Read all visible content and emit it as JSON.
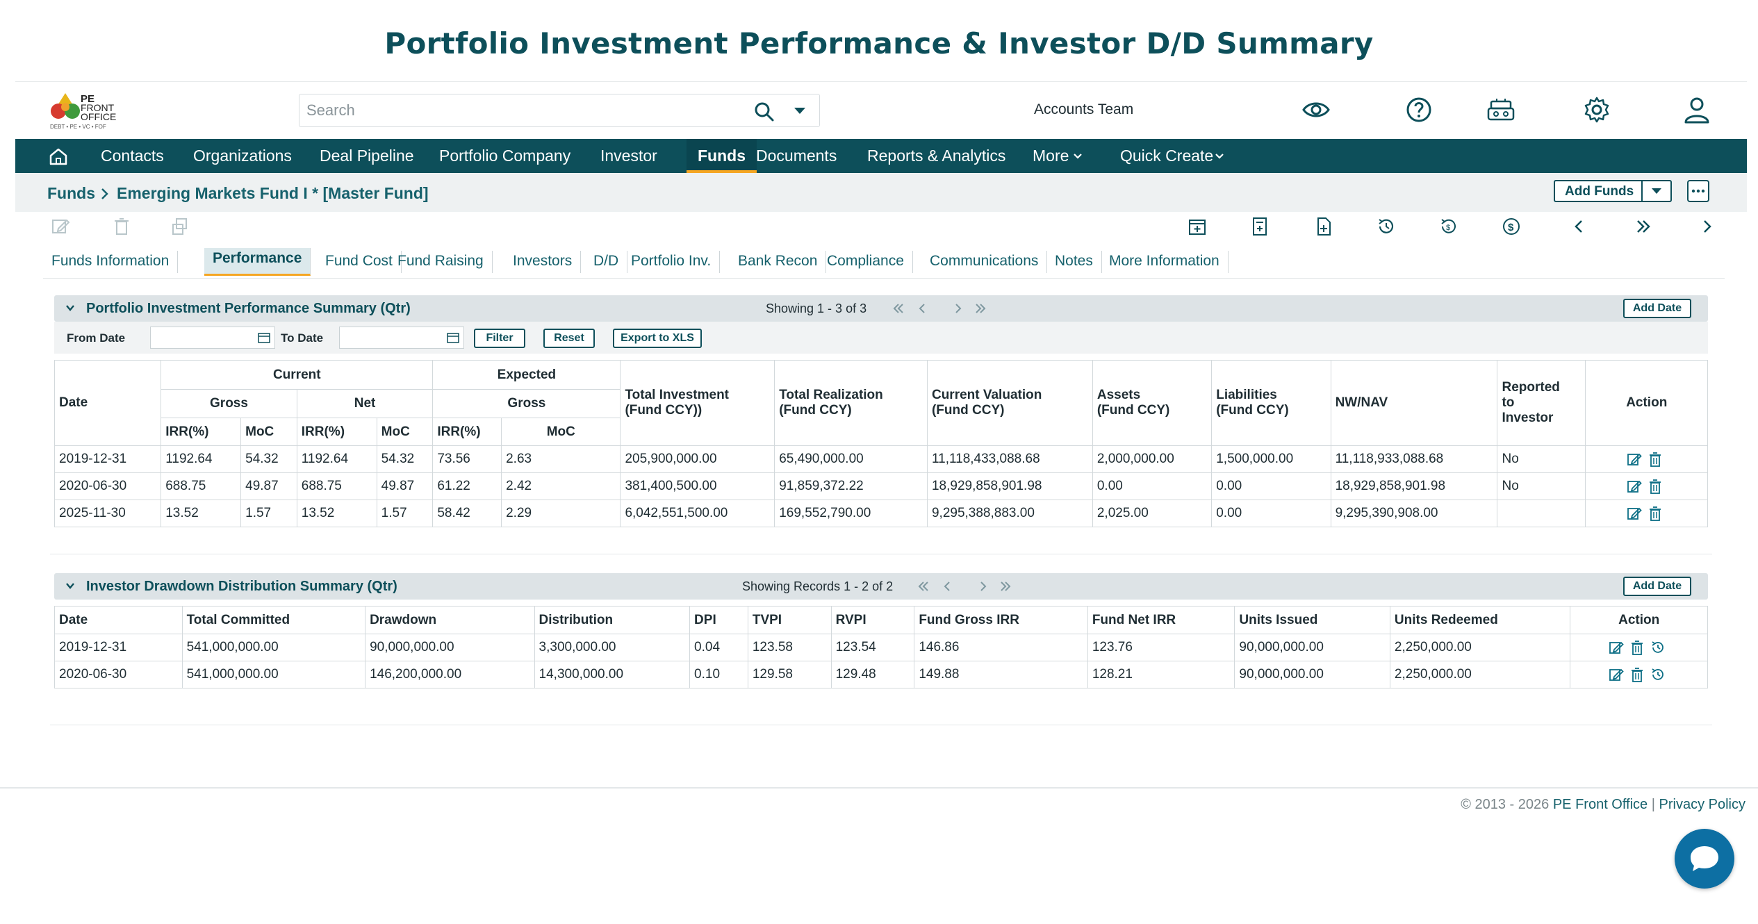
{
  "page_title": "Portfolio Investment Performance & Investor D/D Summary",
  "header": {
    "logo": {
      "line1": "PE",
      "line2": "FRONT",
      "line3": "OFFICE",
      "tagline": "DEBT • PE • VC • FOF"
    },
    "search_placeholder": "Search",
    "team": "Accounts Team",
    "icons": [
      "eye-icon",
      "help-icon",
      "robot-icon",
      "gear-icon",
      "user-icon"
    ]
  },
  "nav": {
    "items": [
      "Contacts",
      "Organizations",
      "Deal Pipeline",
      "Portfolio Company",
      "Investor",
      "Funds",
      "Documents",
      "Reports & Analytics",
      "More",
      "Quick Create"
    ],
    "active": "Funds"
  },
  "breadcrumb": {
    "root": "Funds",
    "current": "Emerging Markets Fund I * [Master Fund]"
  },
  "add_funds_label": "Add Funds",
  "tabs": [
    "Funds Information",
    "Performance",
    "Fund Cost",
    "Fund Raising",
    "Investors",
    "D/D",
    "Portfolio Inv.",
    "Bank Recon",
    "Compliance",
    "Communications",
    "Notes",
    "More Information"
  ],
  "active_tab": "Performance",
  "perf": {
    "title": "Portfolio Investment Performance Summary (Qtr)",
    "showing": "Showing 1 - 3 of 3",
    "add_date": "Add Date",
    "filter": {
      "from_label": "From Date",
      "to_label": "To Date",
      "filter_btn": "Filter",
      "reset_btn": "Reset",
      "export_btn": "Export to XLS"
    },
    "headers": {
      "date": "Date",
      "current": "Current",
      "expected": "Expected",
      "gross": "Gross",
      "net": "Net",
      "irr": "IRR(%)",
      "moc": "MoC",
      "total_investment_1": "Total Investment",
      "total_investment_2": "(Fund CCY))",
      "total_realization_1": "Total Realization",
      "total_realization_2": "(Fund CCY)",
      "current_valuation_1": "Current Valuation",
      "current_valuation_2": "(Fund CCY)",
      "assets_1": "Assets",
      "assets_2": "(Fund CCY)",
      "liabilities_1": "Liabilities",
      "liabilities_2": "(Fund CCY)",
      "nav": "NW/NAV",
      "reported_1": "Reported",
      "reported_2": "to",
      "reported_3": "Investor",
      "action": "Action"
    },
    "rows": [
      {
        "date": "2019-12-31",
        "cg_irr": "1192.64",
        "cg_moc": "54.32",
        "cn_irr": "1192.64",
        "cn_moc": "54.32",
        "eg_irr": "73.56",
        "eg_moc": "2.63",
        "investment": "205,900,000.00",
        "realization": "65,490,000.00",
        "valuation": "11,118,433,088.68",
        "assets": "2,000,000.00",
        "liabilities": "1,500,000.00",
        "nav": "11,118,933,088.68",
        "reported": "No"
      },
      {
        "date": "2020-06-30",
        "cg_irr": "688.75",
        "cg_moc": "49.87",
        "cn_irr": "688.75",
        "cn_moc": "49.87",
        "eg_irr": "61.22",
        "eg_moc": "2.42",
        "investment": "381,400,500.00",
        "realization": "91,859,372.22",
        "valuation": "18,929,858,901.98",
        "assets": "0.00",
        "liabilities": "0.00",
        "nav": "18,929,858,901.98",
        "reported": "No"
      },
      {
        "date": "2025-11-30",
        "cg_irr": "13.52",
        "cg_moc": "1.57",
        "cn_irr": "13.52",
        "cn_moc": "1.57",
        "eg_irr": "58.42",
        "eg_moc": "2.29",
        "investment": "6,042,551,500.00",
        "realization": "169,552,790.00",
        "valuation": "9,295,388,883.00",
        "assets": "2,025.00",
        "liabilities": "0.00",
        "nav": "9,295,390,908.00",
        "reported": ""
      }
    ]
  },
  "dd": {
    "title": "Investor Drawdown Distribution Summary (Qtr)",
    "showing": "Showing Records 1 - 2 of 2",
    "add_date": "Add Date",
    "headers": {
      "date": "Date",
      "committed": "Total Committed",
      "drawdown": "Drawdown",
      "distribution": "Distribution",
      "dpi": "DPI",
      "tvpi": "TVPI",
      "rvpi": "RVPI",
      "gross_irr": "Fund Gross IRR",
      "net_irr": "Fund Net IRR",
      "issued": "Units Issued",
      "redeemed": "Units Redeemed",
      "action": "Action"
    },
    "rows": [
      {
        "date": "2019-12-31",
        "committed": "541,000,000.00",
        "drawdown": "90,000,000.00",
        "distribution": "3,300,000.00",
        "dpi": "0.04",
        "tvpi": "123.58",
        "rvpi": "123.54",
        "gross_irr": "146.86",
        "net_irr": "123.76",
        "issued": "90,000,000.00",
        "redeemed": "2,250,000.00"
      },
      {
        "date": "2020-06-30",
        "committed": "541,000,000.00",
        "drawdown": "146,200,000.00",
        "distribution": "14,300,000.00",
        "dpi": "0.10",
        "tvpi": "129.58",
        "rvpi": "129.48",
        "gross_irr": "149.88",
        "net_irr": "128.21",
        "issued": "90,000,000.00",
        "redeemed": "2,250,000.00"
      }
    ]
  },
  "footer": {
    "copyright": "© 2013 - 2026",
    "brand": "PE Front Office",
    "sep": "|",
    "privacy": "Privacy Policy"
  },
  "colors": {
    "brand": "#0d4f5a",
    "accent": "#f5a623",
    "link": "#16616c",
    "chat": "#0d6fa3"
  }
}
